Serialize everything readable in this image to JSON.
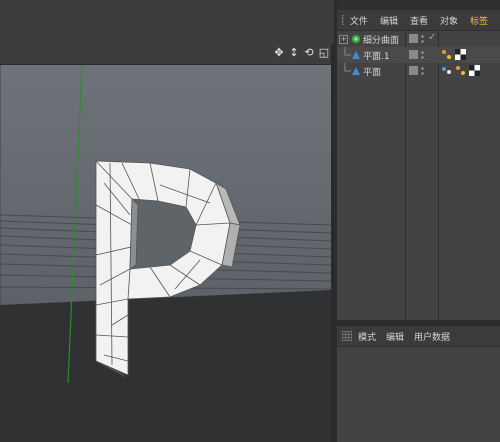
{
  "object_manager": {
    "menu": [
      {
        "label": "文件",
        "active": false
      },
      {
        "label": "编辑",
        "active": false
      },
      {
        "label": "查看",
        "active": false
      },
      {
        "label": "对象",
        "active": false
      },
      {
        "label": "标签",
        "active": true
      }
    ],
    "objects": [
      {
        "name": "细分曲面",
        "icon": "subdivision-surface-icon",
        "expander": "+",
        "checked": true
      },
      {
        "name": "平面.1",
        "icon": "plane-icon",
        "expander": "",
        "checked": false
      },
      {
        "name": "平面",
        "icon": "plane-icon",
        "expander": "",
        "checked": false
      }
    ]
  },
  "attribute_manager": {
    "menu": [
      {
        "label": "模式"
      },
      {
        "label": "编辑"
      },
      {
        "label": "用户数据"
      }
    ]
  },
  "viewport": {
    "nav_icons": [
      "move-view-icon",
      "zoom-view-icon",
      "rotate-view-icon",
      "maximize-view-icon"
    ]
  },
  "colors": {
    "accent_tab": "#f0c040",
    "checkmark": "#5fd35f",
    "model": "#f2f2f2",
    "axis_line": "#2e8b2e"
  }
}
